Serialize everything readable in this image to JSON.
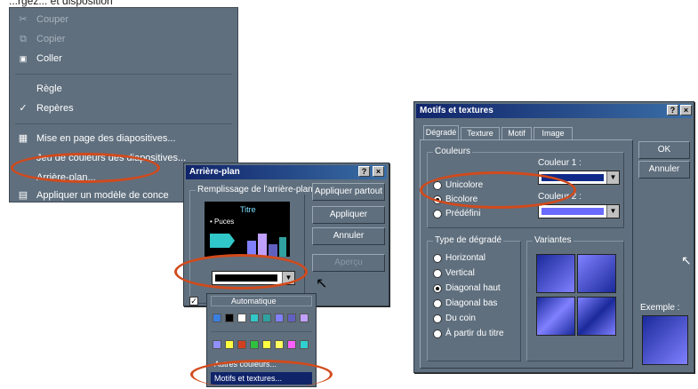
{
  "caption": "...rgez... et disposition",
  "context_menu": {
    "items": [
      {
        "label": "Couper",
        "icon": "scissors-icon",
        "glyph": "✂"
      },
      {
        "label": "Copier",
        "icon": "copy-icon",
        "glyph": "⧉"
      },
      {
        "label": "Coller",
        "icon": "paste-icon",
        "glyph": "📋"
      },
      {
        "label": "Règle",
        "icon": "",
        "glyph": ""
      },
      {
        "label": "Repères",
        "icon": "check-icon",
        "glyph": "✓"
      },
      {
        "label": "Mise en page des diapositives...",
        "icon": "page-setup-icon",
        "glyph": "▦"
      },
      {
        "label": "Jeu de couleurs des diapositives...",
        "icon": "",
        "glyph": ""
      },
      {
        "label": "Arrière-plan...",
        "icon": "",
        "glyph": ""
      },
      {
        "label": "Appliquer un modèle de conce",
        "icon": "template-icon",
        "glyph": "▤"
      }
    ]
  },
  "background_dialog": {
    "title": "Arrière-plan",
    "help": "?",
    "close": "×",
    "group_label": "Remplissage de l'arrière-plan",
    "preview": {
      "title": "Titre",
      "bullet": "• Puces"
    },
    "buttons": {
      "apply_all": "Appliquer partout",
      "apply": "Appliquer",
      "cancel": "Annuler",
      "preview": "Aperçu"
    }
  },
  "color_dropdown": {
    "automatic": "Automatique",
    "more_colors": "Autres couleurs...",
    "fill_effects": "Motifs et textures...",
    "row1": [
      "#3a7ee0",
      "#000000",
      "#ffffff",
      "#30c8c8",
      "#30a0a0",
      "#8080ff",
      "#6060c0",
      "#c0a0ff"
    ],
    "row2": [
      "#9090ff",
      "#ffff40",
      "#d04020",
      "#30c040",
      "#ffff40",
      "#ffff60",
      "#ff60ff",
      "#30d0d0"
    ]
  },
  "fill_effects_dialog": {
    "title": "Motifs et textures",
    "help": "?",
    "close": "×",
    "tabs": [
      "Dégradé",
      "Texture",
      "Motif",
      "Image"
    ],
    "colors_group": "Couleurs",
    "color_options": [
      "Unicolore",
      "Bicolore",
      "Prédéfini"
    ],
    "color1_label": "Couleur 1 :",
    "color2_label": "Couleur 2 :",
    "color1": "#102a8a",
    "color2": "#6a6aff",
    "shading_group": "Type de dégradé",
    "shading_options": [
      "Horizontal",
      "Vertical",
      "Diagonal haut",
      "Diagonal bas",
      "Du coin",
      "À partir du titre"
    ],
    "variants_label": "Variantes",
    "sample_label": "Exemple :",
    "buttons": {
      "ok": "OK",
      "cancel": "Annuler"
    }
  }
}
